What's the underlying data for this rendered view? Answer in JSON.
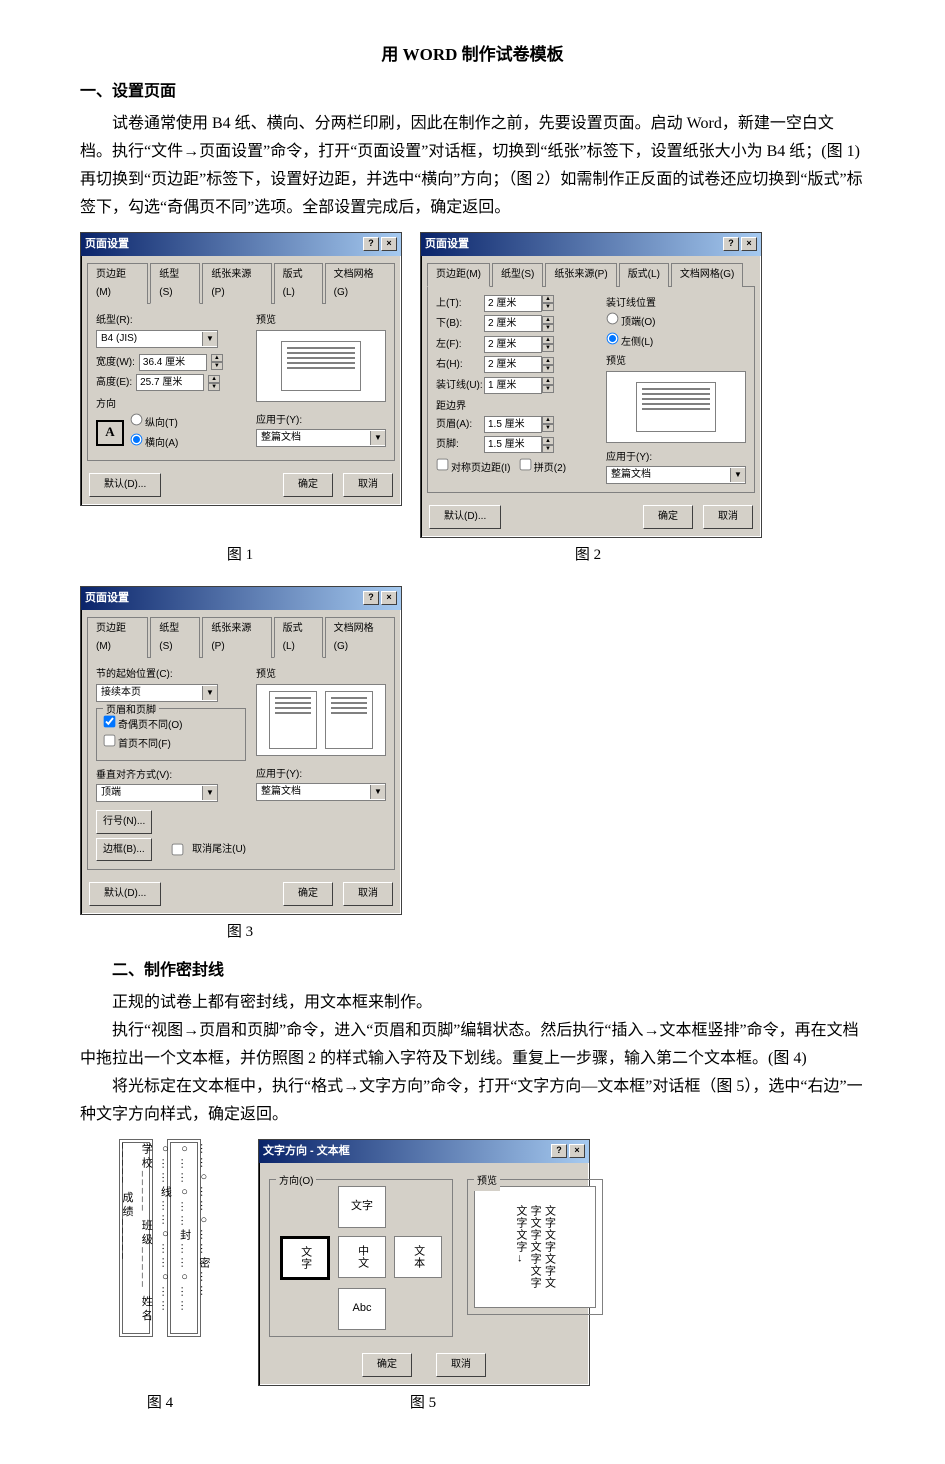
{
  "doc": {
    "title": "用 WORD 制作试卷模板",
    "h1": "一、设置页面",
    "p1": "试卷通常使用 B4 纸、横向、分两栏印刷，因此在制作之前，先要设置页面。启动 Word，新建一空白文档。执行“文件→页面设置”命令，打开“页面设置”对话框，切换到“纸张”标签下，设置纸张大小为 B4 纸；(图 1)再切换到“页边距”标签下，设置好边距，并选中“横向”方向；（图 2）如需制作正反面的试卷还应切换到“版式”标签下，勾选“奇偶页不同”选项。全部设置完成后，确定返回。",
    "cap1": "图 1",
    "cap2": "图 2",
    "cap3": "图 3",
    "h2": "二、制作密封线",
    "p2": "正规的试卷上都有密封线，用文本框来制作。",
    "p3": "执行“视图→页眉和页脚”命令，进入“页眉和页脚”编辑状态。然后执行“插入→文本框竖排”命令，再在文档中拖拉出一个文本框，并仿照图 2 的样式输入字符及下划线。重复上一步骤，输入第二个文本框。(图 4)",
    "p4": "将光标定在文本框中，执行“格式→文字方向”命令，打开“文字方向—文本框”对话框（图 5），选中“右边”一种文字方向样式，确定返回。",
    "cap4": "图 4",
    "cap5": "图 5"
  },
  "dlg_common": {
    "title": "页面设置",
    "help": "?",
    "close": "×",
    "default_btn": "默认(D)...",
    "ok": "确定",
    "cancel": "取消",
    "apply_to_lbl": "应用于(Y):",
    "apply_to_val": "整篇文档",
    "preview_lbl": "预览"
  },
  "dlg_tabs": {
    "margin": "页边距(M)",
    "paper": "纸型(S)",
    "source": "纸张来源(P)",
    "layout": "版式(L)",
    "grid": "文档网格(G)"
  },
  "fig1": {
    "paper_lbl": "纸型(R):",
    "paper_val": "B4 (JIS)",
    "width_lbl": "宽度(W):",
    "width_val": "36.4 厘米",
    "height_lbl": "高度(E):",
    "height_val": "25.7 厘米",
    "orient_lbl": "方向",
    "portrait": "纵向(T)",
    "landscape": "横向(A)"
  },
  "fig2": {
    "top_lbl": "上(T):",
    "top_val": "2 厘米",
    "bottom_lbl": "下(B):",
    "bottom_val": "2 厘米",
    "left_lbl": "左(F):",
    "left_val": "2 厘米",
    "right_lbl": "右(H):",
    "right_val": "2 厘米",
    "gutter_lbl": "装订线(U):",
    "gutter_val": "1 厘米",
    "from_edge": "距边界",
    "header_lbl": "页眉(A):",
    "header_val": "1.5 厘米",
    "footer_lbl": "页脚:",
    "footer_val": "1.5 厘米",
    "mirror_lbl": "对称页边距(I)",
    "twoup_lbl": "拼页(2)",
    "gutpos_lbl": "装订线位置",
    "gut_top": "顶端(O)",
    "gut_left": "左侧(L)"
  },
  "fig3": {
    "section_lbl": "节的起始位置(C):",
    "section_val": "接续本页",
    "hf_group": "页眉和页脚",
    "odd_even": "奇偶页不同(O)",
    "first_diff": "首页不同(F)",
    "valign_lbl": "垂直对齐方式(V):",
    "valign_val": "顶端",
    "linenum": "行号(N)...",
    "border": "边框(B)...",
    "suppress": "取消尾注(U)"
  },
  "fig4": {
    "box1": "学校_____ 班级_____ 姓名_____ 成绩_____",
    "box2": "……○……○……密……○……○……封……○……○……线……○……○……"
  },
  "fig5": {
    "title": "文字方向 - 文本框",
    "orient_lbl": "方向(O)",
    "preview_lbl": "预览",
    "sample": "文字",
    "sample2": "中文",
    "sample3": "文本",
    "sample4": "Abc",
    "preview_text": "文字文字文字文\n字文字文字文字\n文字文字→",
    "ok": "确定",
    "cancel": "取消"
  }
}
